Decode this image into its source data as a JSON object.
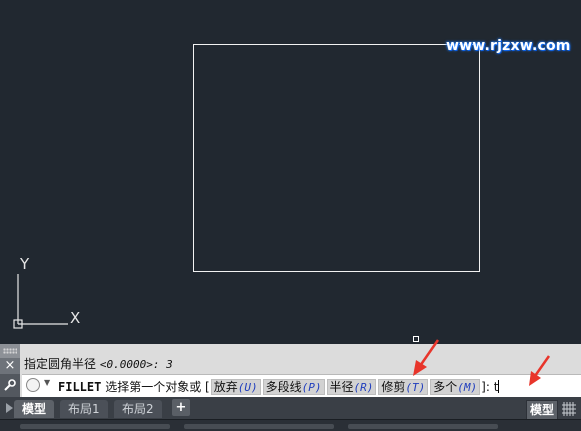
{
  "watermark": "www.rjzxw.com",
  "ucs": {
    "y_label": "Y",
    "x_label": "X"
  },
  "command": {
    "history": "指定圆角半径",
    "history_value": "<0.0000>: 3",
    "command_name": "FILLET",
    "prompt": "选择第一个对象或",
    "open_bracket": "[",
    "options": [
      {
        "label": "放弃",
        "key": "(U)"
      },
      {
        "label": "多段线",
        "key": "(P)"
      },
      {
        "label": "半径",
        "key": "(R)"
      },
      {
        "label": "修剪",
        "key": "(T)"
      },
      {
        "label": "多个",
        "key": "(M)"
      }
    ],
    "close_bracket": "]:",
    "typed": "t"
  },
  "tabs": [
    {
      "label": "模型",
      "active": true
    },
    {
      "label": "布局1",
      "active": false
    },
    {
      "label": "布局2",
      "active": false
    }
  ],
  "tab_add": "+",
  "status": {
    "model_button": "模型"
  },
  "colors": {
    "canvas": "#212830",
    "arrow": "#e8352b",
    "option_key": "#1f3dbd"
  },
  "icons": {
    "close": "×",
    "tool": "wrench-icon",
    "command": "fillet-command-icon"
  }
}
